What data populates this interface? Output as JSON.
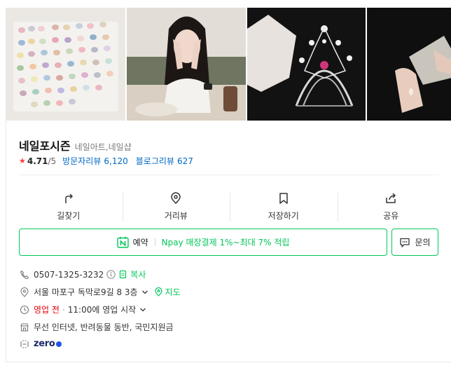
{
  "place": {
    "name": "네일포시즌",
    "category": "네일아트,네일샵",
    "rating": "4.71",
    "rating_max": "/5",
    "visitor_review_label": "방문자리뷰",
    "visitor_review_count": "6,120",
    "blog_review_label": "블로그리뷰",
    "blog_review_count": "627"
  },
  "actions": [
    {
      "label": "길찾기",
      "icon": "directions-icon"
    },
    {
      "label": "거리뷰",
      "icon": "location-pin-icon"
    },
    {
      "label": "저장하기",
      "icon": "bookmark-icon"
    },
    {
      "label": "공유",
      "icon": "share-icon"
    }
  ],
  "booking": {
    "label": "예약",
    "npay_text": "Npay 매장결제 1%~최대 7% 적립",
    "inquiry_label": "문의"
  },
  "info": {
    "phone": "0507-1325-3232",
    "copy_label": "복사",
    "address": "서울 마포구 독막로9길 8 3층",
    "map_label": "지도",
    "status": "영업 전",
    "status_sep": "·",
    "hours": "11:00에 영업 시작",
    "amenities": "무선 인터넷, 반려동물 동반, 국민지원금",
    "zero_logo": "zero"
  },
  "colors": {
    "accent_green": "#03c75a",
    "link_blue": "#0068c3",
    "status_red": "#e2000b",
    "star_red": "#ff3b3b"
  }
}
